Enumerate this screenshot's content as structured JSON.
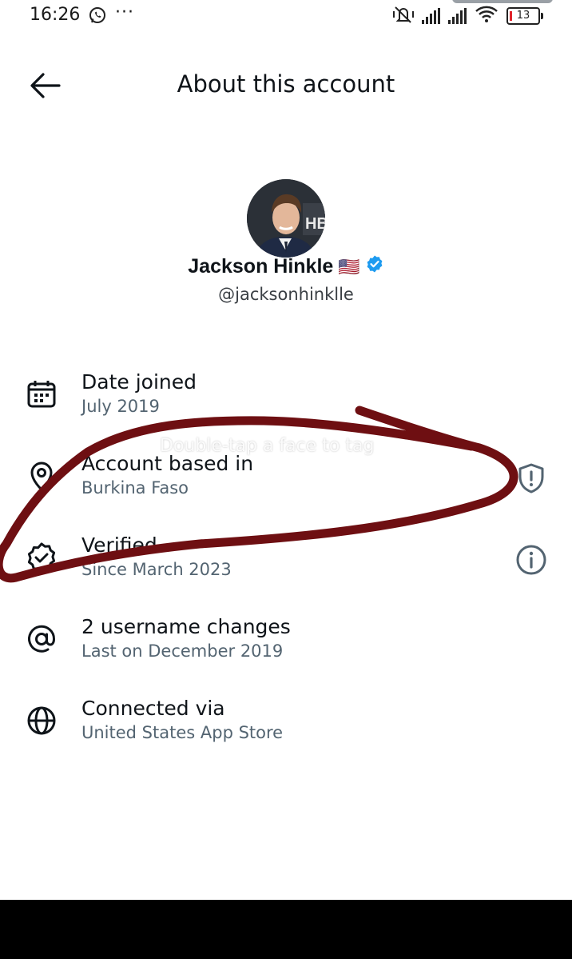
{
  "status_bar": {
    "time": "16:26",
    "more": "···",
    "battery": "13"
  },
  "header": {
    "title": "About this account"
  },
  "profile": {
    "name": "Jackson Hinkle",
    "flag": "🇺🇸",
    "handle": "@jacksonhinklle",
    "avatar_text": "HB"
  },
  "overlay": {
    "hint": "Double-tap a face to tag"
  },
  "info_rows": [
    {
      "icon": "calendar-icon",
      "title": "Date joined",
      "subtitle": "July 2019"
    },
    {
      "icon": "location-pin-icon",
      "title": "Account based in",
      "subtitle": "Burkina Faso",
      "action_icon": "shield-alert-icon"
    },
    {
      "icon": "verified-badge-icon",
      "title": "Verified",
      "subtitle": "Since March 2023",
      "action_icon": "info-icon"
    },
    {
      "icon": "at-sign-icon",
      "title": "2 username changes",
      "subtitle": "Last on December 2019"
    },
    {
      "icon": "globe-icon",
      "title": "Connected via",
      "subtitle": "United States App Store"
    }
  ],
  "colors": {
    "text_primary": "#0f1419",
    "text_secondary": "#536471",
    "verified_blue": "#1d9bf0",
    "annotation": "#6e0f12"
  }
}
